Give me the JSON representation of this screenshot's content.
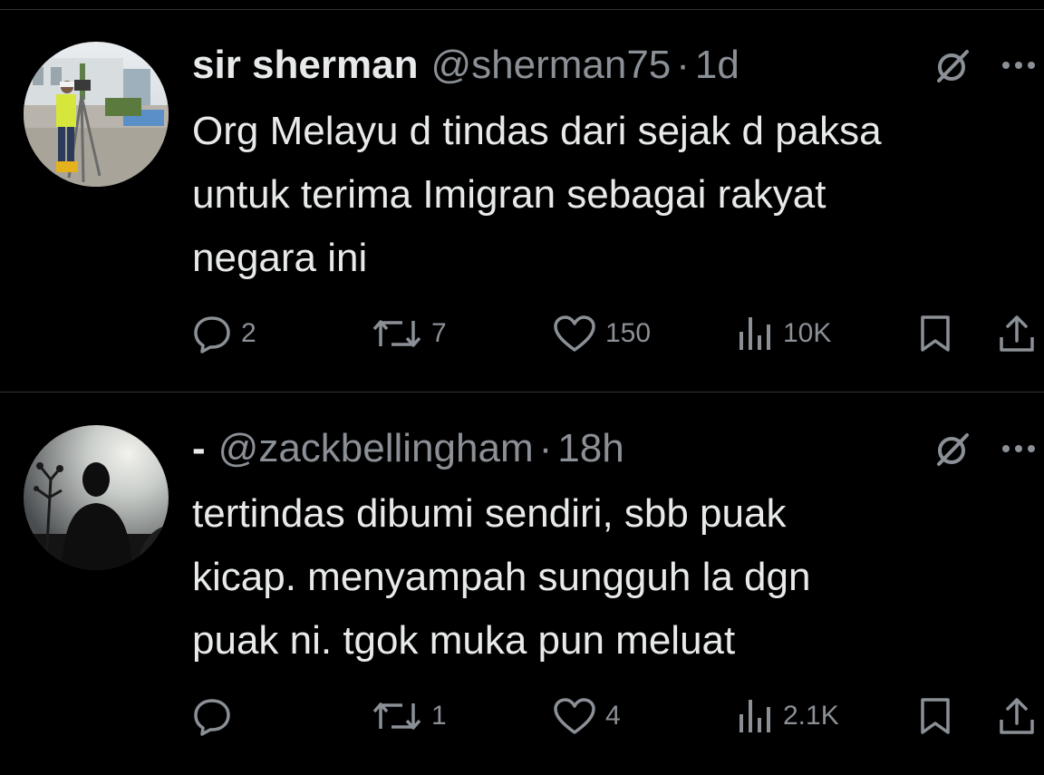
{
  "tweets": [
    {
      "display_name": "sir sherman",
      "handle": "@sherman75",
      "separator": "·",
      "time": "1d",
      "text_lines": [
        "Org Melayu d tindas dari sejak d paksa",
        "untuk terima Imigran sebagai rakyat",
        "negara ini"
      ],
      "stats": {
        "replies": "2",
        "reposts": "7",
        "likes": "150",
        "views": "10K"
      },
      "icons": [
        "grok-icon",
        "more-icon",
        "reply-icon",
        "repost-icon",
        "like-icon",
        "views-icon",
        "bookmark-icon",
        "share-icon"
      ]
    },
    {
      "display_name": "-",
      "handle": "@zackbellingham",
      "separator": "·",
      "time": "18h",
      "text_lines": [
        "tertindas dibumi sendiri, sbb puak",
        "kicap. menyampah sungguh la dgn",
        "puak ni. tgok muka pun meluat"
      ],
      "stats": {
        "replies": "",
        "reposts": "1",
        "likes": "4",
        "views": "2.1K"
      },
      "icons": [
        "grok-icon",
        "more-icon",
        "reply-icon",
        "repost-icon",
        "like-icon",
        "views-icon",
        "bookmark-icon",
        "share-icon"
      ]
    }
  ],
  "colors": {
    "background": "#000000",
    "text": "#e7e9ea",
    "muted": "#8b9096",
    "divider": "#2f3336"
  }
}
